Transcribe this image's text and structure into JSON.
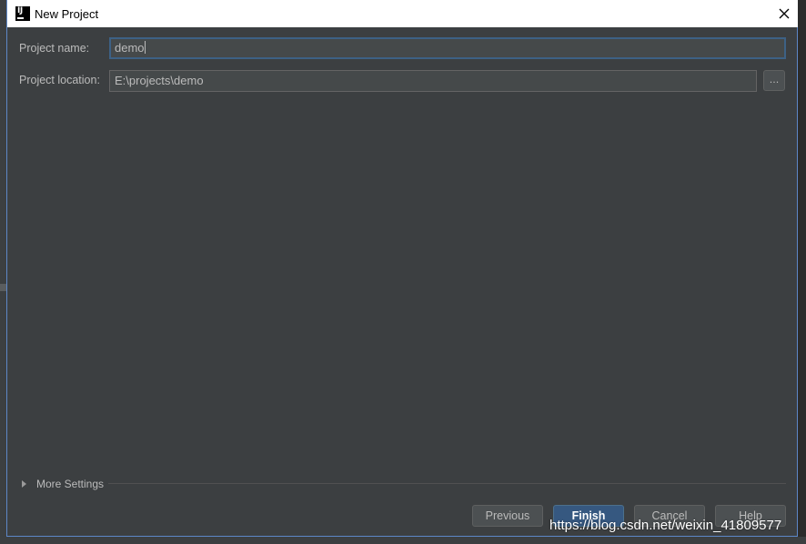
{
  "dialog": {
    "title": "New Project",
    "project_name_label": "Project name:",
    "project_name_value": "demo",
    "project_location_label": "Project location:",
    "project_location_value": "E:\\projects\\demo",
    "browse_label": "...",
    "more_settings_label": "More Settings",
    "buttons": {
      "previous": "Previous",
      "finish": "Finish",
      "cancel": "Cancel",
      "help": "Help"
    }
  },
  "watermark": "https://blog.csdn.net/weixin_41809577",
  "colors": {
    "dialog_bg": "#3c3f41",
    "accent": "#365880",
    "focus_border": "#3d6185",
    "text": "#bbbbbb"
  },
  "icons": {
    "app": "intellij-idea-icon",
    "close": "close-icon",
    "expand": "triangle-right-icon"
  }
}
